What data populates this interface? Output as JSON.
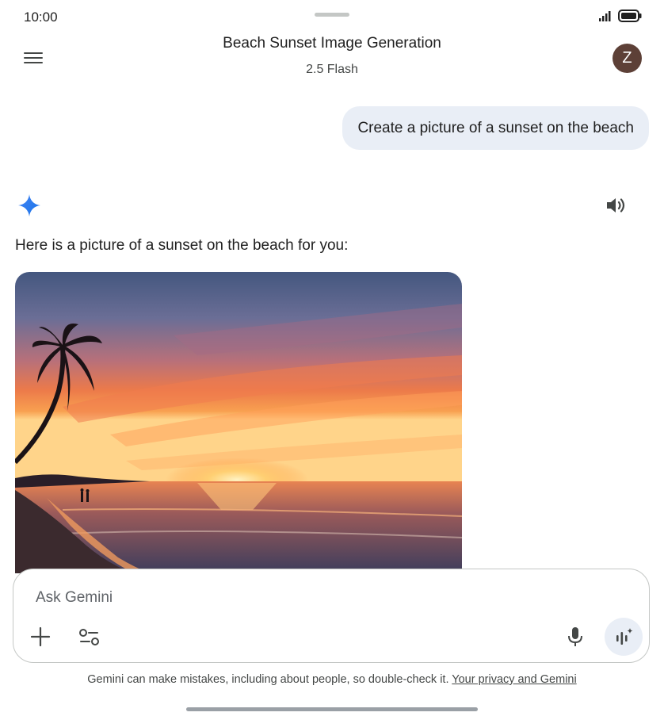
{
  "status_bar": {
    "time": "10:00",
    "battery_icon": "battery-full-icon",
    "signal_icon": "signal-icon"
  },
  "header": {
    "title": "Beach Sunset Image Generation",
    "model": "2.5 Flash",
    "avatar_letter": "Z",
    "avatar_color": "#5d4037",
    "menu_icon": "menu-icon"
  },
  "chat": {
    "user_message": "Create a picture of a sunset on the beach",
    "response_text": "Here is a picture of a sunset on the beach for you:",
    "gemini_icon": "gemini-sparkle-icon",
    "speaker_icon": "speaker-icon",
    "generated_image": "beach sunset with palm tree"
  },
  "composer": {
    "placeholder": "Ask Gemini",
    "plus_icon": "plus-icon",
    "tools_icon": "tools-icon",
    "mic_icon": "mic-icon",
    "live_icon": "live-icon"
  },
  "footer": {
    "disclaimer": "Gemini can make mistakes, including about people, so double-check it.",
    "privacy_link": "Your privacy and Gemini"
  },
  "colors": {
    "accent_blue": "#4285f4",
    "bubble_bg": "#e9eef6",
    "text": "#1f1f1f"
  }
}
